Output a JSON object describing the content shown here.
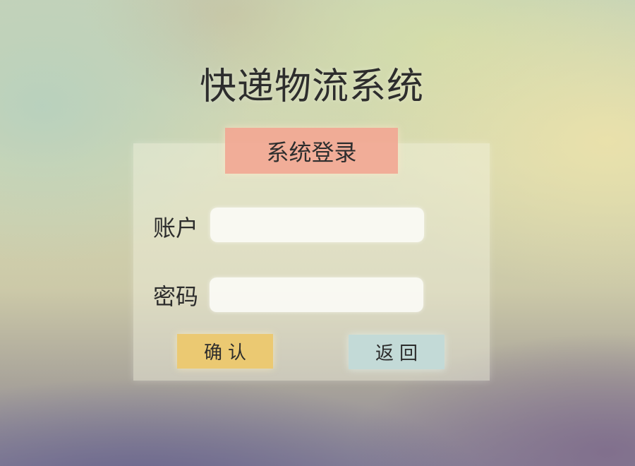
{
  "app": {
    "title": "快递物流系统"
  },
  "login": {
    "banner_label": "系统登录",
    "account": {
      "label": "账户",
      "value": "",
      "placeholder": ""
    },
    "password": {
      "label": "密码",
      "value": "",
      "placeholder": ""
    },
    "confirm_label": "确认",
    "back_label": "返回"
  },
  "colors": {
    "banner": "#f2a894",
    "confirm_button": "#ecc86e",
    "back_button": "#c2dad8",
    "input_background": "#fafaf4"
  }
}
